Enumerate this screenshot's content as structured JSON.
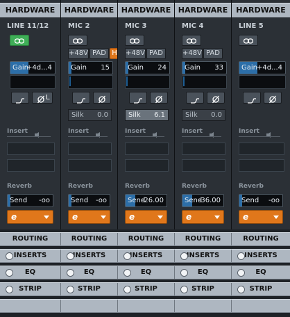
{
  "strips": [
    {
      "header": "HARDWARE",
      "name": "LINE 11/12",
      "link_on": true,
      "has_48v": false,
      "has_pad": false,
      "has_hi": false,
      "gain_label": "Gain",
      "gain_value": "+4d...4",
      "silk_label": "",
      "silk_value": "",
      "silk_active": false,
      "send_label": "Send",
      "send_value": "-oo"
    },
    {
      "header": "HARDWARE",
      "name": "MIC 2",
      "link_on": false,
      "has_48v": true,
      "has_pad": true,
      "has_hi": true,
      "gain_label": "Gain",
      "gain_value": "15",
      "silk_label": "Silk",
      "silk_value": "0.0",
      "silk_active": false,
      "send_label": "Send",
      "send_value": "-oo"
    },
    {
      "header": "HARDWARE",
      "name": "MIC 3",
      "link_on": false,
      "has_48v": true,
      "has_pad": true,
      "has_hi": false,
      "gain_label": "Gain",
      "gain_value": "24",
      "silk_label": "Silk",
      "silk_value": "6.1",
      "silk_active": true,
      "send_label": "Send",
      "send_value": "-26.00"
    },
    {
      "header": "HARDWARE",
      "name": "MIC 4",
      "link_on": false,
      "has_48v": true,
      "has_pad": true,
      "has_hi": false,
      "gain_label": "Gain",
      "gain_value": "33",
      "silk_label": "Silk",
      "silk_value": "0.0",
      "silk_active": false,
      "send_label": "Send",
      "send_value": "-36.00"
    },
    {
      "header": "HARDWARE",
      "name": "LINE 5",
      "link_on": false,
      "has_48v": false,
      "has_pad": false,
      "has_hi": false,
      "gain_label": "Gain",
      "gain_value": "+4d...4",
      "silk_label": "",
      "silk_value": "",
      "silk_active": false,
      "send_label": "Send",
      "send_value": "-oo"
    }
  ],
  "labels": {
    "phantom": "+48V",
    "pad": "PAD",
    "hi": "H",
    "insert": "Insert",
    "reverb": "Reverb",
    "eq_curve": "⌐",
    "phase": "Ø",
    "link": "L"
  },
  "bottom_bars": {
    "routing": "ROUTING",
    "inserts": "INSERTS",
    "eq": "EQ",
    "strip": "STRIP"
  },
  "colors": {
    "accent_orange": "#e0771b",
    "link_green": "#3fae57",
    "header_gray": "#aeb7c1",
    "value_blue": "#2c6ea8"
  }
}
